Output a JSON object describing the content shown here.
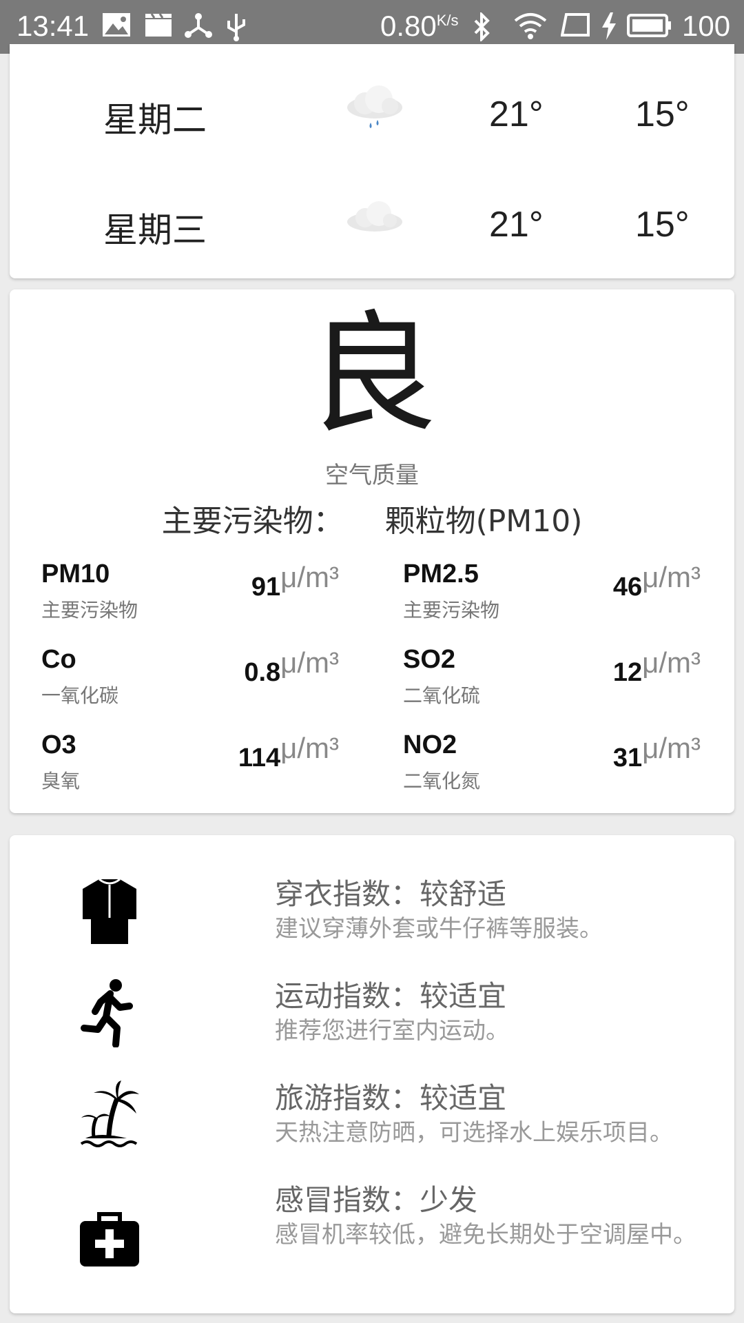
{
  "status_bar": {
    "time": "13:41",
    "net_speed": "0.80",
    "net_unit": "K/s",
    "battery": "100"
  },
  "forecast": [
    {
      "day": "星期二",
      "icon": "rain-cloud-icon",
      "high": "21°",
      "low": "15°"
    },
    {
      "day": "星期三",
      "icon": "cloud-icon",
      "high": "21°",
      "low": "15°"
    }
  ],
  "air_quality": {
    "grade": "良",
    "label": "空气质量",
    "primary_label": "主要污染物：",
    "primary_value": "颗粒物(PM10)",
    "unit": "μ/m³",
    "pollutants": [
      {
        "name": "PM10",
        "desc": "主要污染物",
        "value": "91"
      },
      {
        "name": "PM2.5",
        "desc": "主要污染物",
        "value": "46"
      },
      {
        "name": "Co",
        "desc": "一氧化碳",
        "value": "0.8"
      },
      {
        "name": "SO2",
        "desc": "二氧化硫",
        "value": "12"
      },
      {
        "name": "O3",
        "desc": "臭氧",
        "value": "114"
      },
      {
        "name": "NO2",
        "desc": "二氧化氮",
        "value": "31"
      }
    ]
  },
  "indices": [
    {
      "icon": "shirt-icon",
      "title": "穿衣指数：较舒适",
      "desc": "建议穿薄外套或牛仔裤等服装。"
    },
    {
      "icon": "running-icon",
      "title": "运动指数：较适宜",
      "desc": "推荐您进行室内运动。"
    },
    {
      "icon": "palm-island-icon",
      "title": "旅游指数：较适宜",
      "desc": "天热注意防晒，可选择水上娱乐项目。"
    },
    {
      "icon": "first-aid-kit-icon",
      "title": "感冒指数：少发",
      "desc": "感冒机率较低，避免长期处于空调屋中。"
    }
  ]
}
